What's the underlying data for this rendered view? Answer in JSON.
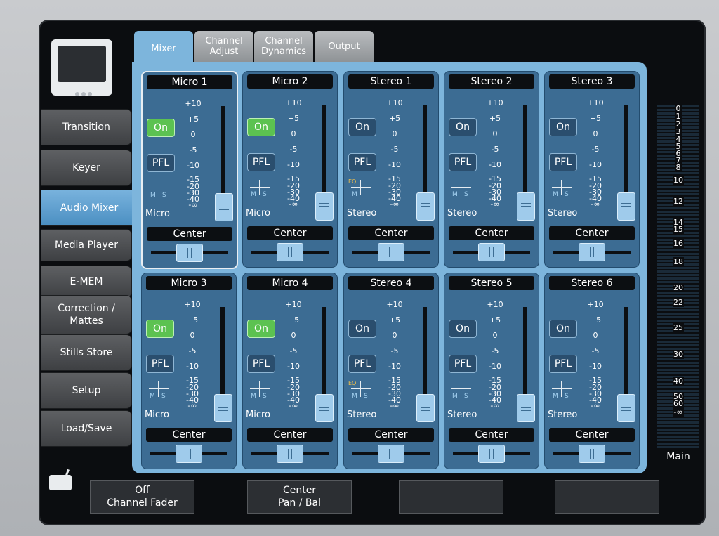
{
  "tabs": [
    {
      "label": "Mixer",
      "active": true
    },
    {
      "label": "Channel Adjust",
      "active": false
    },
    {
      "label": "Channel Dynamics",
      "active": false
    },
    {
      "label": "Output",
      "active": false
    }
  ],
  "side_menu": [
    {
      "label": "Transition",
      "active": false
    },
    {
      "label": "Keyer",
      "active": false
    },
    {
      "label": "Audio Mixer",
      "active": true
    },
    {
      "label": "Media Player",
      "active": false
    },
    {
      "label": "E-MEM",
      "active": false
    },
    {
      "label": "Correction / Mattes",
      "active": false
    },
    {
      "label": "Stills Store",
      "active": false
    },
    {
      "label": "Setup",
      "active": false
    },
    {
      "label": "Load/Save",
      "active": false
    }
  ],
  "fader_scale": [
    "+10",
    "+5",
    "0",
    "-5",
    "-10",
    "-15",
    "-20",
    "-30",
    "-40",
    "-∞"
  ],
  "channels": [
    {
      "title": "Micro 1",
      "on_label": "On",
      "on_lit": true,
      "pfl_label": "PFL",
      "eq": "",
      "m_label": "M",
      "s_label": "S",
      "type": "Micro",
      "pan": "Center",
      "selected": true
    },
    {
      "title": "Micro 2",
      "on_label": "On",
      "on_lit": true,
      "pfl_label": "PFL",
      "eq": "",
      "m_label": "M",
      "s_label": "S",
      "type": "Micro",
      "pan": "Center",
      "selected": false
    },
    {
      "title": "Stereo 1",
      "on_label": "On",
      "on_lit": false,
      "pfl_label": "PFL",
      "eq": "EQ",
      "m_label": "M",
      "s_label": "",
      "type": "Stereo",
      "pan": "Center",
      "selected": false
    },
    {
      "title": "Stereo 2",
      "on_label": "On",
      "on_lit": false,
      "pfl_label": "PFL",
      "eq": "",
      "m_label": "M",
      "s_label": "S",
      "type": "Stereo",
      "pan": "Center",
      "selected": false
    },
    {
      "title": "Stereo 3",
      "on_label": "On",
      "on_lit": false,
      "pfl_label": "PFL",
      "eq": "",
      "m_label": "M",
      "s_label": "S",
      "type": "Stereo",
      "pan": "Center",
      "selected": false
    },
    {
      "title": "Micro 3",
      "on_label": "On",
      "on_lit": true,
      "pfl_label": "PFL",
      "eq": "",
      "m_label": "M",
      "s_label": "S",
      "type": "Micro",
      "pan": "Center",
      "selected": false
    },
    {
      "title": "Micro 4",
      "on_label": "On",
      "on_lit": true,
      "pfl_label": "PFL",
      "eq": "",
      "m_label": "M",
      "s_label": "S",
      "type": "Micro",
      "pan": "Center",
      "selected": false
    },
    {
      "title": "Stereo 4",
      "on_label": "On",
      "on_lit": false,
      "pfl_label": "PFL",
      "eq": "EQ",
      "m_label": "M",
      "s_label": "S",
      "type": "Stereo",
      "pan": "Center",
      "selected": false
    },
    {
      "title": "Stereo 5",
      "on_label": "On",
      "on_lit": false,
      "pfl_label": "PFL",
      "eq": "",
      "m_label": "M",
      "s_label": "S",
      "type": "Stereo",
      "pan": "Center",
      "selected": false
    },
    {
      "title": "Stereo 6",
      "on_label": "On",
      "on_lit": false,
      "pfl_label": "PFL",
      "eq": "",
      "m_label": "M",
      "s_label": "S",
      "type": "Stereo",
      "pan": "Center",
      "selected": false
    }
  ],
  "main_meter": {
    "label": "Main",
    "scale": [
      "0",
      "1",
      "2",
      "3",
      "4",
      "5",
      "6",
      "7",
      "8",
      "10",
      "12",
      "14",
      "15",
      "16",
      "18",
      "20",
      "22",
      "25",
      "30",
      "40",
      "50",
      "60",
      "-∞"
    ]
  },
  "soft_keys": [
    {
      "line1": "Off",
      "line2": "Channel Fader"
    },
    {
      "line1": "Center",
      "line2": "Pan / Bal"
    },
    {
      "line1": "",
      "line2": ""
    },
    {
      "line1": "",
      "line2": ""
    }
  ],
  "colors": {
    "panel": "#7db5dc",
    "strip": "#3c6c93",
    "on_lit": "#5cc251",
    "eq": "#f0c04c"
  }
}
